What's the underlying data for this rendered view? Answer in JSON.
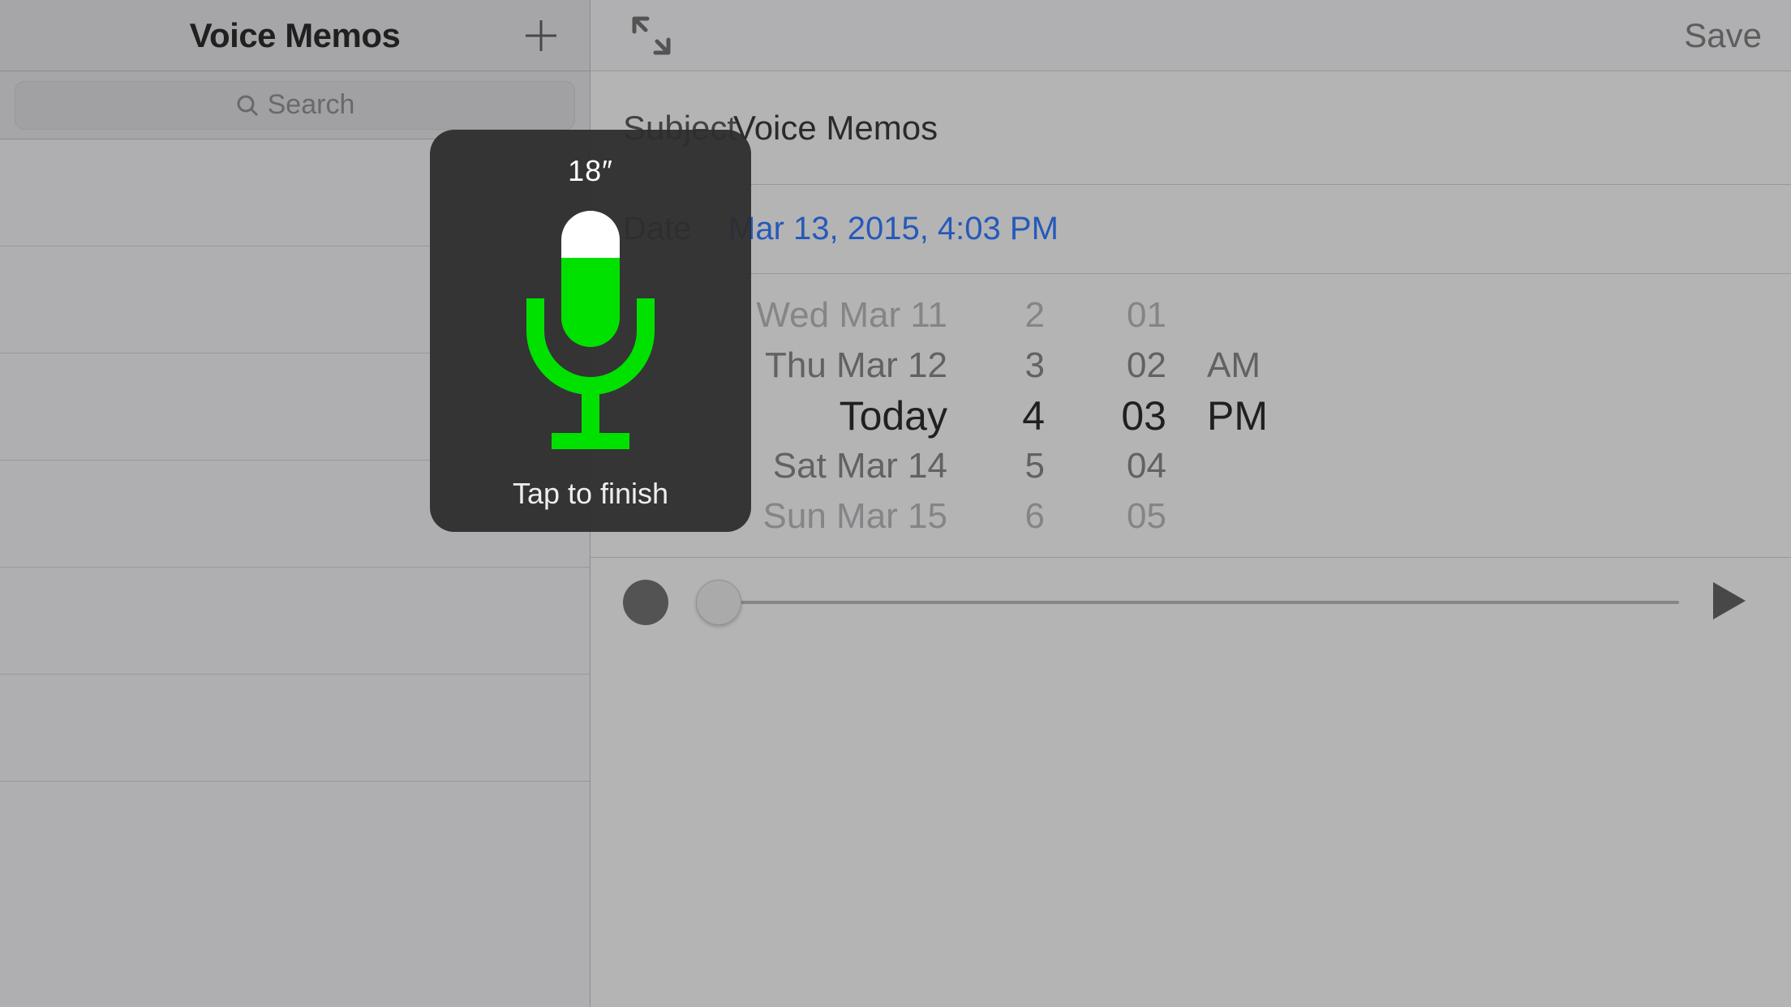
{
  "left": {
    "title": "Voice Memos",
    "search_placeholder": "Search"
  },
  "right": {
    "save_label": "Save",
    "subject_label": "Subject",
    "subject_value": "Voice Memos",
    "date_label": "Date",
    "date_value": "Mar 13, 2015, 4:03 PM",
    "picker": {
      "day": [
        "Wed Mar 11",
        "Thu Mar 12",
        "Today",
        "Sat Mar 14",
        "Sun Mar 15"
      ],
      "hour": [
        "2",
        "3",
        "4",
        "5",
        "6"
      ],
      "minute": [
        "01",
        "02",
        "03",
        "04",
        "05"
      ],
      "ampm": [
        "AM",
        "PM"
      ]
    }
  },
  "modal": {
    "duration": "18″",
    "hint": "Tap to finish"
  },
  "colors": {
    "mic_green": "#00e100",
    "link_blue": "#0b60ff"
  }
}
